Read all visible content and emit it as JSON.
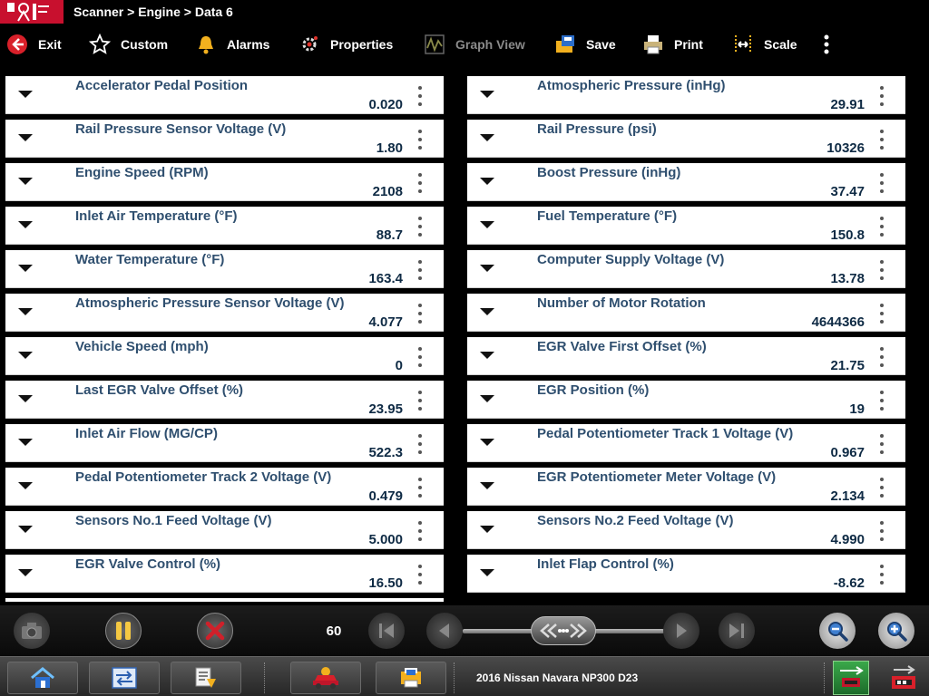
{
  "header": {
    "breadcrumb": "Scanner > Engine > Data 6"
  },
  "toolbar": {
    "exit": "Exit",
    "custom": "Custom",
    "alarms": "Alarms",
    "properties": "Properties",
    "graph_view": "Graph View",
    "save": "Save",
    "print": "Print",
    "scale": "Scale"
  },
  "left_params": [
    {
      "name": "Accelerator Pedal Position",
      "value": "0.020"
    },
    {
      "name": "Rail Pressure Sensor Voltage (V)",
      "value": "1.80"
    },
    {
      "name": "Engine Speed (RPM)",
      "value": "2108"
    },
    {
      "name": "Inlet Air Temperature (°F)",
      "value": "88.7"
    },
    {
      "name": "Water Temperature (°F)",
      "value": "163.4"
    },
    {
      "name": "Atmospheric Pressure Sensor Voltage (V)",
      "value": "4.077"
    },
    {
      "name": "Vehicle Speed (mph)",
      "value": "0"
    },
    {
      "name": "Last EGR Valve Offset (%)",
      "value": "23.95"
    },
    {
      "name": "Inlet Air Flow (MG/CP)",
      "value": "522.3"
    },
    {
      "name": "Pedal Potentiometer Track 2 Voltage (V)",
      "value": "0.479"
    },
    {
      "name": "Sensors No.1 Feed Voltage (V)",
      "value": "5.000"
    },
    {
      "name": "EGR Valve Control (%)",
      "value": "16.50"
    }
  ],
  "right_params": [
    {
      "name": "Atmospheric Pressure (inHg)",
      "value": "29.91"
    },
    {
      "name": "Rail Pressure (psi)",
      "value": "10326"
    },
    {
      "name": "Boost Pressure (inHg)",
      "value": "37.47"
    },
    {
      "name": "Fuel Temperature (°F)",
      "value": "150.8"
    },
    {
      "name": "Computer Supply Voltage (V)",
      "value": "13.78"
    },
    {
      "name": "Number of Motor Rotation",
      "value": "4644366"
    },
    {
      "name": "EGR Valve First Offset (%)",
      "value": "21.75"
    },
    {
      "name": "EGR Position (%)",
      "value": "19"
    },
    {
      "name": "Pedal Potentiometer Track 1 Voltage (V)",
      "value": "0.967"
    },
    {
      "name": "EGR Potentiometer Meter Voltage (V)",
      "value": "2.134"
    },
    {
      "name": "Sensors No.2 Feed Voltage (V)",
      "value": "4.990"
    },
    {
      "name": "Inlet Flap Control (%)",
      "value": "-8.62"
    }
  ],
  "controls": {
    "sample_count": "60"
  },
  "taskbar": {
    "vehicle": "2016 Nissan Navara NP300 D23"
  },
  "colors": {
    "param_name": "#2f4f6f",
    "param_value": "#0e2a44",
    "logo_red": "#c8102e",
    "alarm_yellow": "#f2b01e",
    "stop_red": "#d0202a",
    "pause_yellow": "#f5c842"
  }
}
